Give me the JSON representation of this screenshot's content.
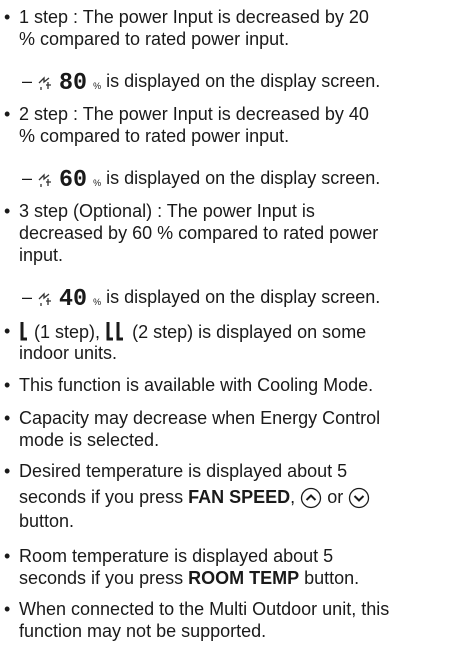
{
  "items": [
    {
      "lines": [
        "1 step : The power Input is decreased by 20",
        "% compared to rated power input."
      ],
      "display_value": "80",
      "display_suffix": "is displayed on the display screen."
    },
    {
      "lines": [
        "2 step : The power Input is decreased by 40",
        "% compared to rated power input."
      ],
      "display_value": "60",
      "display_suffix": "is displayed on the display screen."
    },
    {
      "lines": [
        "3 step (Optional) : The power Input is",
        "decreased by 60 % compared to rated power",
        "input."
      ],
      "display_value": "40",
      "display_suffix": "is displayed on the display screen."
    }
  ],
  "indoor_units": {
    "step1": "(1 step),",
    "step2": "(2 step) is displayed on some",
    "line2": "indoor units."
  },
  "cooling_note": "This function is available with Cooling Mode.",
  "capacity_note": {
    "line1": "Capacity may decrease when Energy Control",
    "line2": "mode is selected."
  },
  "desired_temp": {
    "line1": "Desired temperature is displayed about 5",
    "line2_prefix": "seconds if you press",
    "line2_bold": "FAN SPEED",
    "line2_sep": ",",
    "line2_or": "or",
    "line3": "button."
  },
  "room_temp": {
    "line1": "Room temperature is displayed about 5",
    "line2_prefix": "seconds if you press",
    "line2_bold": "ROOM TEMP",
    "line2_suffix": "button."
  },
  "multi_outdoor": {
    "line1": "When connected to the Multi Outdoor unit, this",
    "line2": "function may not be supported."
  },
  "symbols": {
    "bullet": "•",
    "dash": "–",
    "percent": "%"
  },
  "icons": {
    "energy_control": "power-plug-icon",
    "up": "up-arrow-button-icon",
    "down": "down-arrow-button-icon"
  }
}
